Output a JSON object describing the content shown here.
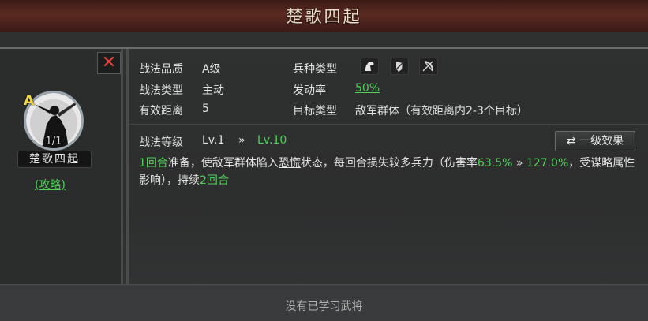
{
  "title": "楚歌四起",
  "skill_card": {
    "grade": "A",
    "count": "1/1",
    "name": "楚歌四起",
    "guide_link": "(攻略)"
  },
  "attributes": {
    "quality_label": "战法品质",
    "quality_value": "A级",
    "troop_label": "兵种类型",
    "troop_icons": [
      "cavalry-icon",
      "shield-icon",
      "bow-icon"
    ],
    "type_label": "战法类型",
    "type_value": "主动",
    "rate_label": "发动率",
    "rate_value": "50%",
    "range_label": "有效距离",
    "range_value": "5",
    "target_label": "目标类型",
    "target_value": "敌军群体（有效距离内2-3个目标）"
  },
  "level": {
    "label": "战法等级",
    "current": "Lv.1",
    "arrow": "»",
    "max": "Lv.10",
    "effect_button": "⇄ 一级效果"
  },
  "description": {
    "rounds_prep": "1回合",
    "text_1": "准备，使敌军群体陷入",
    "keyword": "恐慌",
    "text_2": "状态，每回合损失较多兵力（伤害率",
    "rate_from": "63.5%",
    "rate_arrow": " » ",
    "rate_to": "127.0%",
    "text_3": "，受谋略属性影响），持续",
    "rounds_last": "2回合"
  },
  "footer": {
    "text": "没有已学习武将"
  },
  "colors": {
    "accent_green": "#4fd15a",
    "grade_gold": "#f1d74b",
    "close_red": "#e0443c"
  }
}
